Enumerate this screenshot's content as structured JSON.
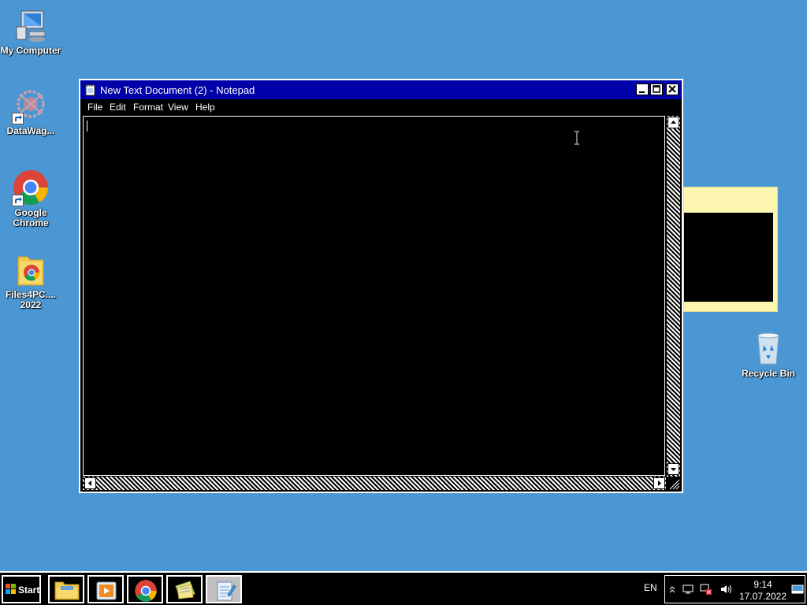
{
  "desktop": {
    "icons": [
      {
        "label": "My Computer",
        "icon": "computer-icon"
      },
      {
        "label": "DataWag...",
        "icon": "datawag-app-icon"
      },
      {
        "label": "Google Chrome",
        "icon": "chrome-icon"
      },
      {
        "label": "Files4PC.... 2022",
        "icon": "folder-chrome-icon"
      },
      {
        "label": "Recycle Bin",
        "icon": "recycle-bin-icon"
      }
    ]
  },
  "notepad": {
    "title": "New Text Document (2) - Notepad",
    "menu": [
      "File",
      "Edit",
      "Format",
      "View",
      "Help"
    ],
    "content": ""
  },
  "taskbar": {
    "start_label": "Start",
    "apps": [
      "file-explorer-icon",
      "media-player-icon",
      "chrome-icon",
      "sticky-notes-icon",
      "notepad-icon"
    ],
    "active_app": "notepad-icon",
    "language": "EN",
    "time": "9:14",
    "date": "17.07.2022"
  },
  "colors": {
    "desktop": "#4a97d4",
    "title_bar": "#0000a8",
    "sticky_note": "#fdf6b0"
  }
}
